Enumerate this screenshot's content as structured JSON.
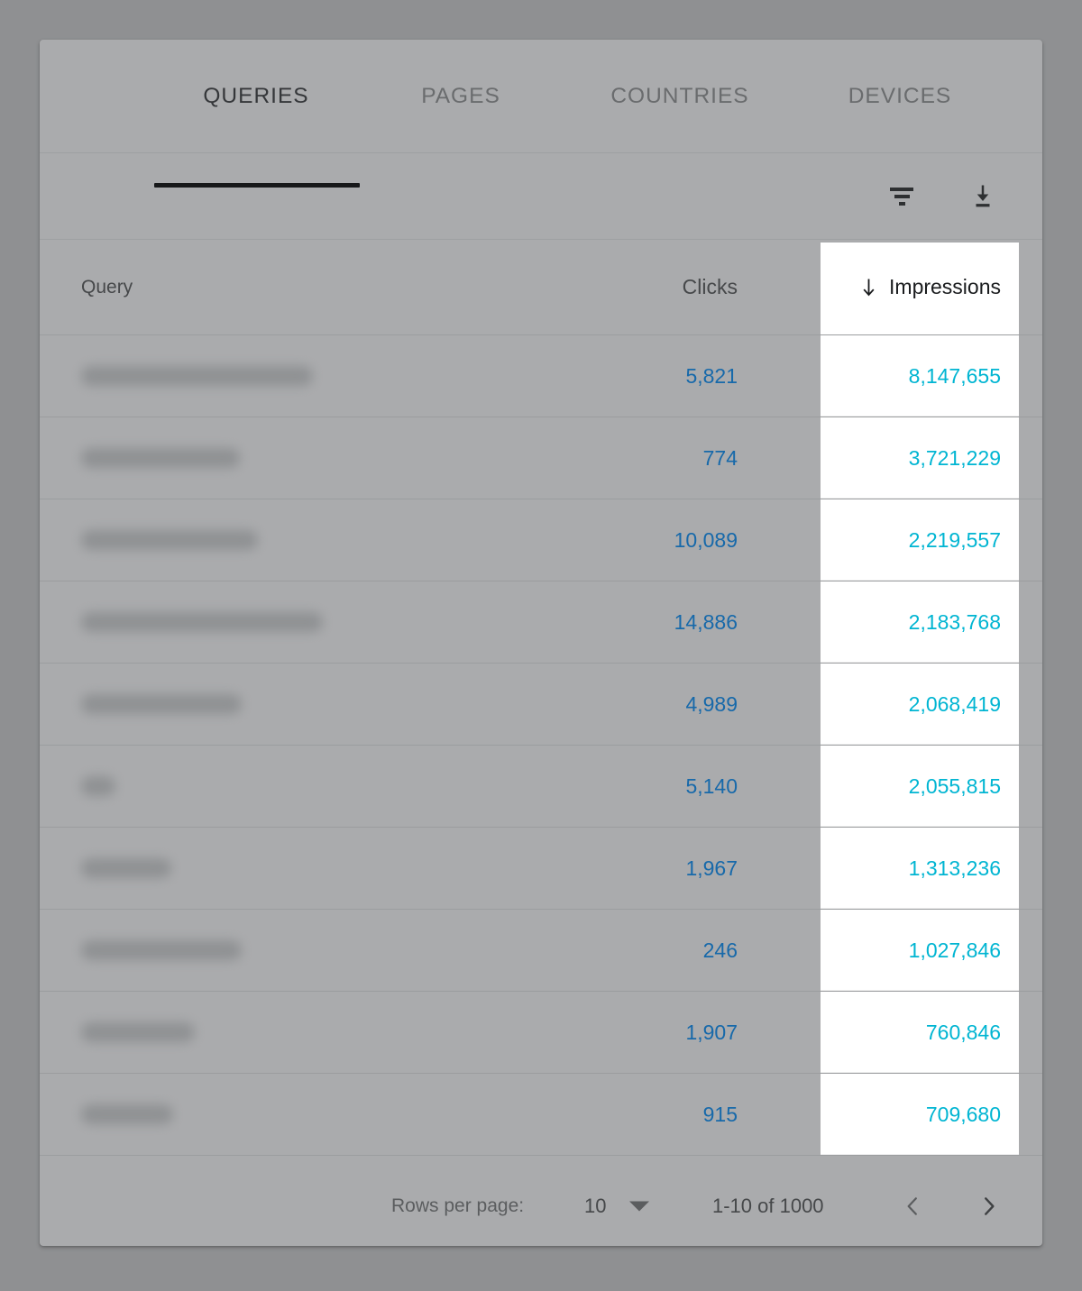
{
  "tabs": [
    {
      "label": "QUERIES",
      "active": true,
      "center": 240
    },
    {
      "label": "PAGES",
      "active": false,
      "center": 467
    },
    {
      "label": "COUNTRIES",
      "active": false,
      "center": 710
    },
    {
      "label": "DEVICES",
      "active": false,
      "center": 954
    }
  ],
  "toolbar": {
    "filter_icon": "filter-icon",
    "download_icon": "download-icon"
  },
  "table": {
    "columns": [
      {
        "key": "query",
        "label": "Query",
        "align": "left",
        "sorted": false
      },
      {
        "key": "clicks",
        "label": "Clicks",
        "align": "right",
        "sorted": false
      },
      {
        "key": "impressions",
        "label": "Impressions",
        "align": "right",
        "sorted": true,
        "sort_direction": "desc",
        "highlighted": true
      }
    ],
    "rows": [
      {
        "query": "",
        "query_redacted": true,
        "redaction_width": 257,
        "clicks": "5,821",
        "impressions": "8,147,655"
      },
      {
        "query": "",
        "query_redacted": true,
        "redaction_width": 176,
        "clicks": "774",
        "impressions": "3,721,229"
      },
      {
        "query": "",
        "query_redacted": true,
        "redaction_width": 196,
        "clicks": "10,089",
        "impressions": "2,219,557"
      },
      {
        "query": "",
        "query_redacted": true,
        "redaction_width": 268,
        "clicks": "14,886",
        "impressions": "2,183,768"
      },
      {
        "query": "",
        "query_redacted": true,
        "redaction_width": 178,
        "clicks": "4,989",
        "impressions": "2,068,419"
      },
      {
        "query": "",
        "query_redacted": true,
        "redaction_width": 38,
        "clicks": "5,140",
        "impressions": "2,055,815"
      },
      {
        "query": "",
        "query_redacted": true,
        "redaction_width": 100,
        "clicks": "1,967",
        "impressions": "1,313,236"
      },
      {
        "query": "",
        "query_redacted": true,
        "redaction_width": 178,
        "clicks": "246",
        "impressions": "1,027,846"
      },
      {
        "query": "",
        "query_redacted": true,
        "redaction_width": 126,
        "clicks": "1,907",
        "impressions": "760,846"
      },
      {
        "query": "",
        "query_redacted": true,
        "redaction_width": 102,
        "clicks": "915",
        "impressions": "709,680"
      }
    ]
  },
  "footer": {
    "rows_per_page_label": "Rows per page:",
    "rows_per_page_value": "10",
    "rows_per_page_options": [
      "10"
    ],
    "range_label": "1-10 of 1000",
    "prev_icon": "chevron-left-icon",
    "next_icon": "chevron-right-icon"
  },
  "colors": {
    "page_background": "#8f9092",
    "card_background": "#aaabad",
    "highlight_background": "#ffffff",
    "impressions_text": "#00b5d2",
    "clicks_text": "#1769aa",
    "active_tab_underline": "#17181a"
  }
}
